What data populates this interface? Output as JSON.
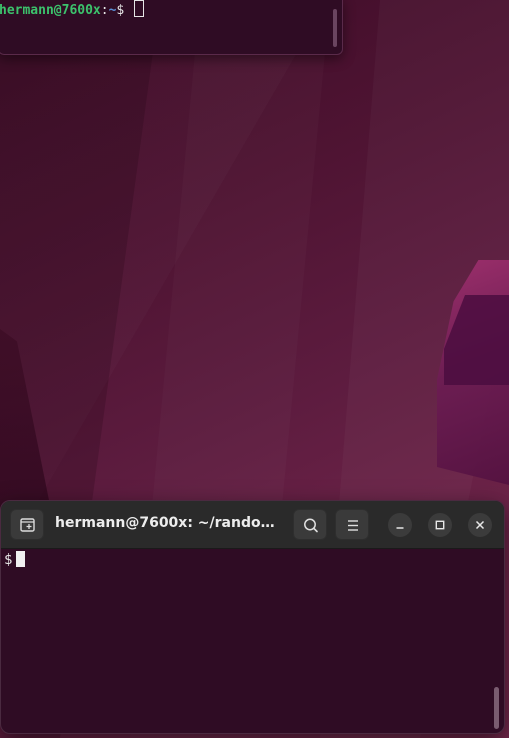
{
  "desktop": {
    "background_colors": [
      "#3c0b26",
      "#5d1c3f",
      "#74284c"
    ],
    "accent_shape_color": "#a0306e"
  },
  "top_terminal": {
    "prompt_user_host": "hermann@7600x",
    "prompt_separator": ":",
    "prompt_path": "~",
    "prompt_symbol": "$",
    "colors": {
      "user_host": "#3cc26c",
      "path": "#5b8fd6",
      "background": "#2f0c24"
    }
  },
  "main_terminal": {
    "title": "hermann@7600x: ~/random...",
    "icons": {
      "new_tab": "new-tab-icon",
      "search": "search-icon",
      "menu": "hamburger-menu-icon",
      "minimize": "minimize-icon",
      "maximize": "maximize-icon",
      "close": "close-icon"
    },
    "prompt_symbol": "$",
    "colors": {
      "headerbar": "#2a2a2a",
      "background": "#2f0c24",
      "text": "#e6e6e6"
    }
  }
}
